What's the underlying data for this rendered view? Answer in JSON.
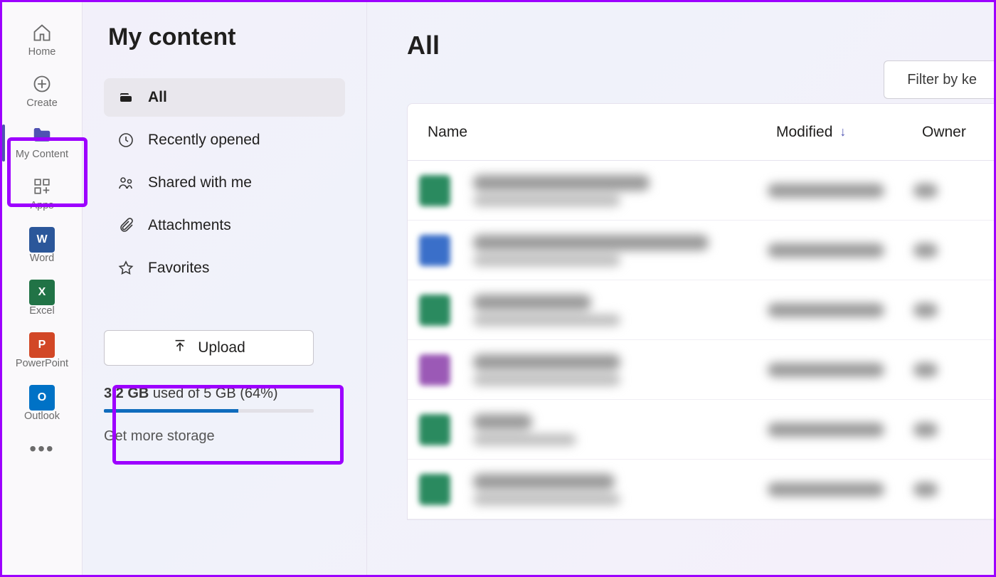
{
  "rail": {
    "items": [
      {
        "label": "Home",
        "icon": "home-icon"
      },
      {
        "label": "Create",
        "icon": "plus-circle-icon"
      },
      {
        "label": "My Content",
        "icon": "folder-icon",
        "active": true
      },
      {
        "label": "Apps",
        "icon": "apps-icon"
      },
      {
        "label": "Word",
        "icon": "word-app-icon"
      },
      {
        "label": "Excel",
        "icon": "excel-app-icon"
      },
      {
        "label": "PowerPoint",
        "icon": "powerpoint-app-icon"
      },
      {
        "label": "Outlook",
        "icon": "outlook-app-icon"
      }
    ]
  },
  "panel": {
    "title": "My content",
    "nav": [
      {
        "label": "All",
        "icon": "stack-icon",
        "selected": true
      },
      {
        "label": "Recently opened",
        "icon": "clock-icon"
      },
      {
        "label": "Shared with me",
        "icon": "people-icon"
      },
      {
        "label": "Attachments",
        "icon": "attachment-icon"
      },
      {
        "label": "Favorites",
        "icon": "star-icon"
      }
    ],
    "upload_label": "Upload",
    "storage": {
      "used": "3.2 GB",
      "used_suffix": " used of 5 GB (64%)",
      "percent": 64,
      "more_link": "Get more storage"
    }
  },
  "main": {
    "heading": "All",
    "filter_label": "Filter by ke",
    "columns": {
      "name": "Name",
      "modified": "Modified",
      "owner": "Owner"
    }
  }
}
